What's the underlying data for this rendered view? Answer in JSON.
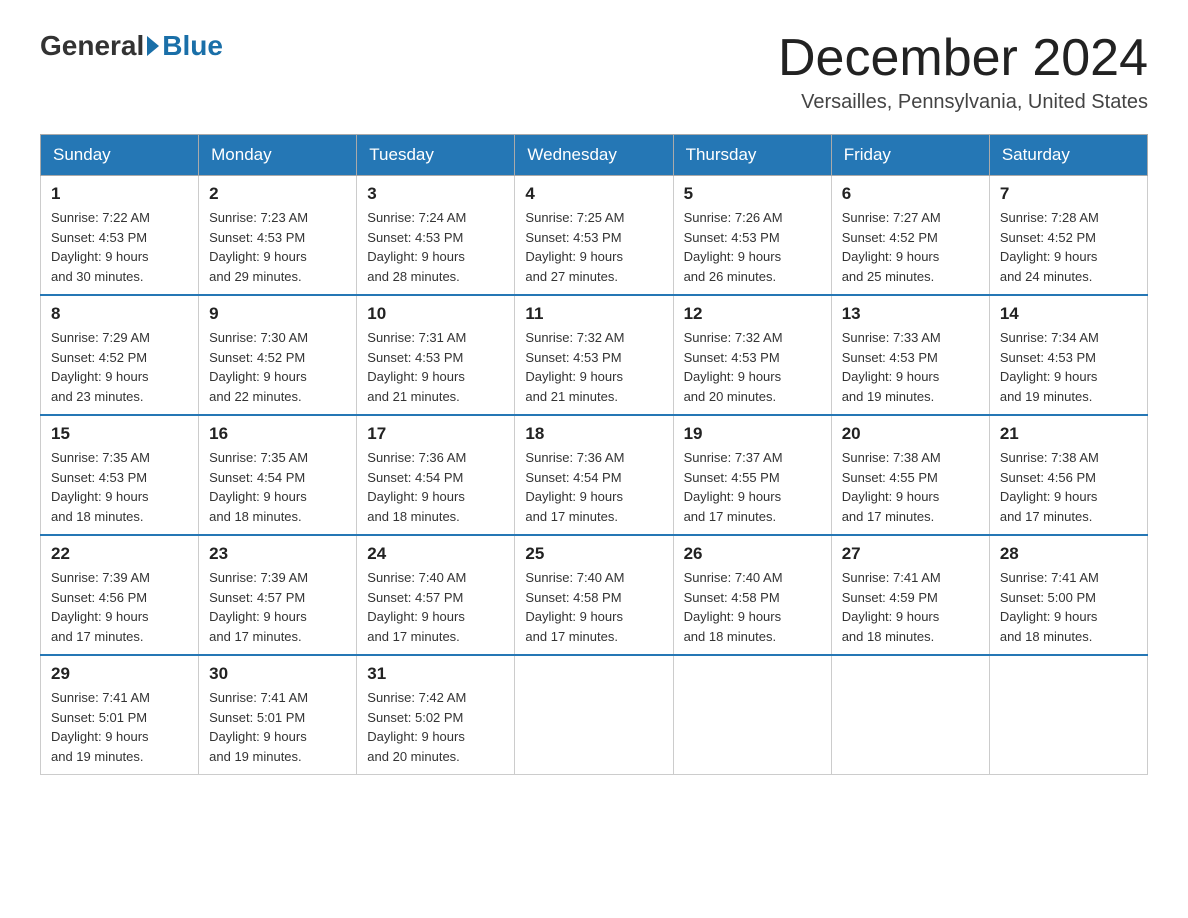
{
  "header": {
    "logo_general": "General",
    "logo_blue": "Blue",
    "title": "December 2024",
    "location": "Versailles, Pennsylvania, United States"
  },
  "days_of_week": [
    "Sunday",
    "Monday",
    "Tuesday",
    "Wednesday",
    "Thursday",
    "Friday",
    "Saturday"
  ],
  "weeks": [
    [
      {
        "day": "1",
        "sunrise": "7:22 AM",
        "sunset": "4:53 PM",
        "daylight": "9 hours and 30 minutes."
      },
      {
        "day": "2",
        "sunrise": "7:23 AM",
        "sunset": "4:53 PM",
        "daylight": "9 hours and 29 minutes."
      },
      {
        "day": "3",
        "sunrise": "7:24 AM",
        "sunset": "4:53 PM",
        "daylight": "9 hours and 28 minutes."
      },
      {
        "day": "4",
        "sunrise": "7:25 AM",
        "sunset": "4:53 PM",
        "daylight": "9 hours and 27 minutes."
      },
      {
        "day": "5",
        "sunrise": "7:26 AM",
        "sunset": "4:53 PM",
        "daylight": "9 hours and 26 minutes."
      },
      {
        "day": "6",
        "sunrise": "7:27 AM",
        "sunset": "4:52 PM",
        "daylight": "9 hours and 25 minutes."
      },
      {
        "day": "7",
        "sunrise": "7:28 AM",
        "sunset": "4:52 PM",
        "daylight": "9 hours and 24 minutes."
      }
    ],
    [
      {
        "day": "8",
        "sunrise": "7:29 AM",
        "sunset": "4:52 PM",
        "daylight": "9 hours and 23 minutes."
      },
      {
        "day": "9",
        "sunrise": "7:30 AM",
        "sunset": "4:52 PM",
        "daylight": "9 hours and 22 minutes."
      },
      {
        "day": "10",
        "sunrise": "7:31 AM",
        "sunset": "4:53 PM",
        "daylight": "9 hours and 21 minutes."
      },
      {
        "day": "11",
        "sunrise": "7:32 AM",
        "sunset": "4:53 PM",
        "daylight": "9 hours and 21 minutes."
      },
      {
        "day": "12",
        "sunrise": "7:32 AM",
        "sunset": "4:53 PM",
        "daylight": "9 hours and 20 minutes."
      },
      {
        "day": "13",
        "sunrise": "7:33 AM",
        "sunset": "4:53 PM",
        "daylight": "9 hours and 19 minutes."
      },
      {
        "day": "14",
        "sunrise": "7:34 AM",
        "sunset": "4:53 PM",
        "daylight": "9 hours and 19 minutes."
      }
    ],
    [
      {
        "day": "15",
        "sunrise": "7:35 AM",
        "sunset": "4:53 PM",
        "daylight": "9 hours and 18 minutes."
      },
      {
        "day": "16",
        "sunrise": "7:35 AM",
        "sunset": "4:54 PM",
        "daylight": "9 hours and 18 minutes."
      },
      {
        "day": "17",
        "sunrise": "7:36 AM",
        "sunset": "4:54 PM",
        "daylight": "9 hours and 18 minutes."
      },
      {
        "day": "18",
        "sunrise": "7:36 AM",
        "sunset": "4:54 PM",
        "daylight": "9 hours and 17 minutes."
      },
      {
        "day": "19",
        "sunrise": "7:37 AM",
        "sunset": "4:55 PM",
        "daylight": "9 hours and 17 minutes."
      },
      {
        "day": "20",
        "sunrise": "7:38 AM",
        "sunset": "4:55 PM",
        "daylight": "9 hours and 17 minutes."
      },
      {
        "day": "21",
        "sunrise": "7:38 AM",
        "sunset": "4:56 PM",
        "daylight": "9 hours and 17 minutes."
      }
    ],
    [
      {
        "day": "22",
        "sunrise": "7:39 AM",
        "sunset": "4:56 PM",
        "daylight": "9 hours and 17 minutes."
      },
      {
        "day": "23",
        "sunrise": "7:39 AM",
        "sunset": "4:57 PM",
        "daylight": "9 hours and 17 minutes."
      },
      {
        "day": "24",
        "sunrise": "7:40 AM",
        "sunset": "4:57 PM",
        "daylight": "9 hours and 17 minutes."
      },
      {
        "day": "25",
        "sunrise": "7:40 AM",
        "sunset": "4:58 PM",
        "daylight": "9 hours and 17 minutes."
      },
      {
        "day": "26",
        "sunrise": "7:40 AM",
        "sunset": "4:58 PM",
        "daylight": "9 hours and 18 minutes."
      },
      {
        "day": "27",
        "sunrise": "7:41 AM",
        "sunset": "4:59 PM",
        "daylight": "9 hours and 18 minutes."
      },
      {
        "day": "28",
        "sunrise": "7:41 AM",
        "sunset": "5:00 PM",
        "daylight": "9 hours and 18 minutes."
      }
    ],
    [
      {
        "day": "29",
        "sunrise": "7:41 AM",
        "sunset": "5:01 PM",
        "daylight": "9 hours and 19 minutes."
      },
      {
        "day": "30",
        "sunrise": "7:41 AM",
        "sunset": "5:01 PM",
        "daylight": "9 hours and 19 minutes."
      },
      {
        "day": "31",
        "sunrise": "7:42 AM",
        "sunset": "5:02 PM",
        "daylight": "9 hours and 20 minutes."
      },
      null,
      null,
      null,
      null
    ]
  ],
  "labels": {
    "sunrise": "Sunrise:",
    "sunset": "Sunset:",
    "daylight": "Daylight:"
  }
}
